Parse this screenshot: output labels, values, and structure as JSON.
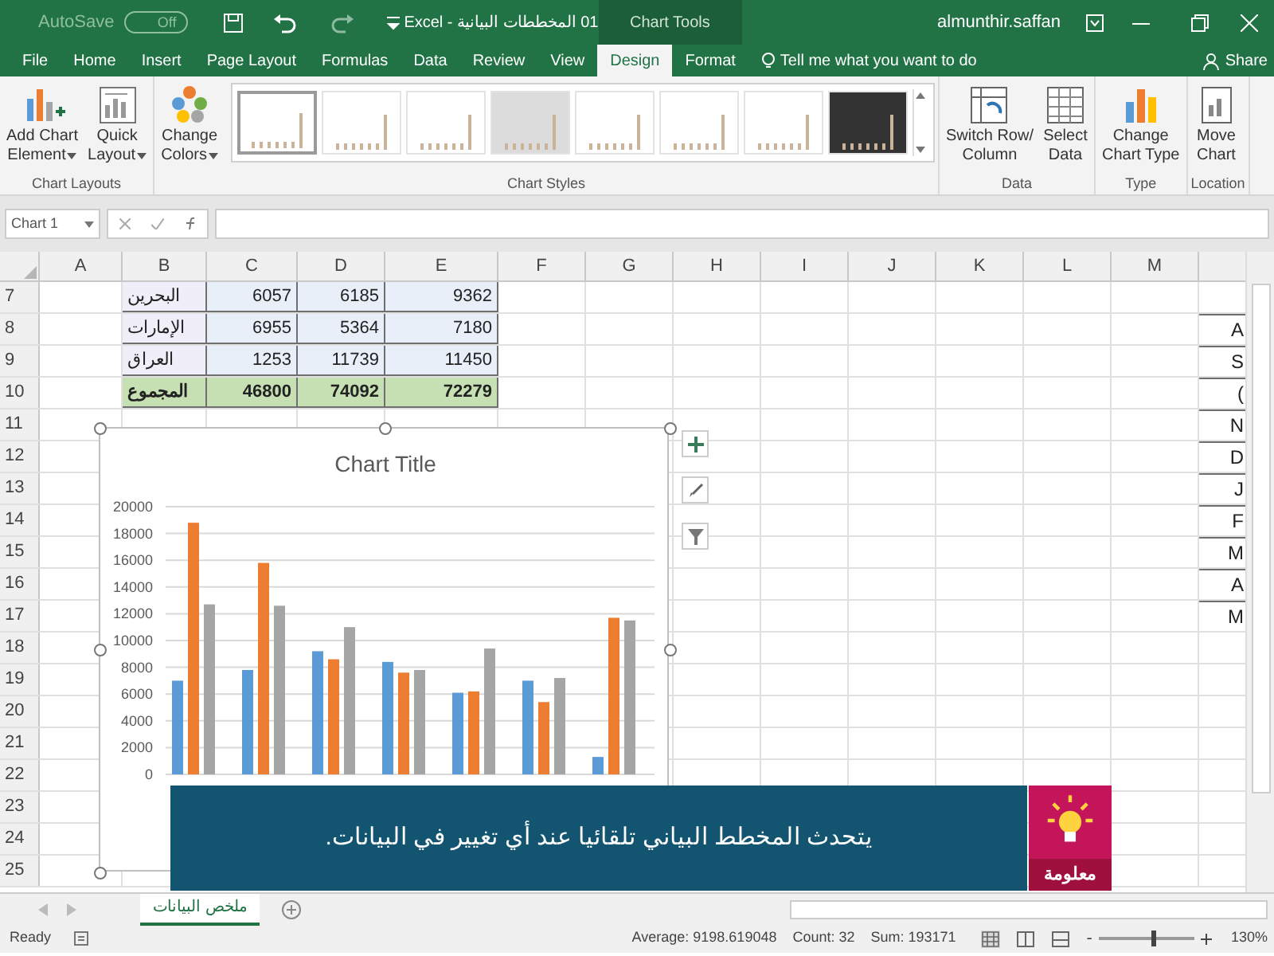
{
  "title_bar": {
    "autosave_label": "AutoSave",
    "autosave_state": "Off",
    "document_title": "01 المخططات البيانية - Excel",
    "context_label": "Chart Tools",
    "user": "almunthir.saffan"
  },
  "tabs": [
    {
      "label": "File",
      "selected": false
    },
    {
      "label": "Home",
      "selected": false
    },
    {
      "label": "Insert",
      "selected": false
    },
    {
      "label": "Page Layout",
      "selected": false
    },
    {
      "label": "Formulas",
      "selected": false
    },
    {
      "label": "Data",
      "selected": false
    },
    {
      "label": "Review",
      "selected": false
    },
    {
      "label": "View",
      "selected": false
    },
    {
      "label": "Design",
      "selected": true
    },
    {
      "label": "Format",
      "selected": false
    }
  ],
  "tell_me": "Tell me what you want to do",
  "share": "Share",
  "ribbon": {
    "groups": [
      {
        "label": "Chart Layouts",
        "buttons": [
          {
            "kind": "add-element",
            "lines": [
              "Add Chart",
              "Element"
            ],
            "dropdown": true
          },
          {
            "kind": "quick-layout",
            "lines": [
              "Quick",
              "Layout"
            ],
            "dropdown": true
          }
        ]
      },
      {
        "label": "Chart Styles",
        "buttons": [
          {
            "kind": "colors",
            "lines": [
              "Change",
              "Colors"
            ],
            "dropdown": true
          }
        ],
        "styles": [
          {
            "kind": "light",
            "selected": true
          },
          {
            "kind": "light",
            "selected": false
          },
          {
            "kind": "light",
            "selected": false
          },
          {
            "kind": "gray",
            "selected": false
          },
          {
            "kind": "light",
            "selected": false
          },
          {
            "kind": "light",
            "selected": false
          },
          {
            "kind": "light",
            "selected": false
          },
          {
            "kind": "dark",
            "selected": false
          }
        ]
      },
      {
        "label": "Data",
        "buttons": [
          {
            "kind": "switch",
            "lines": [
              "Switch Row/",
              "Column"
            ],
            "dropdown": false
          },
          {
            "kind": "select-data",
            "lines": [
              "Select",
              "Data"
            ],
            "dropdown": false
          }
        ]
      },
      {
        "label": "Type",
        "buttons": [
          {
            "kind": "chart-type",
            "lines": [
              "Change",
              "Chart Type"
            ],
            "dropdown": false
          }
        ]
      },
      {
        "label": "Location",
        "buttons": [
          {
            "kind": "move",
            "lines": [
              "Move",
              "Chart"
            ],
            "dropdown": false
          }
        ]
      }
    ]
  },
  "formula_bar": {
    "name_box": "Chart 1"
  },
  "columns": [
    "A",
    "B",
    "C",
    "D",
    "E",
    "F",
    "G",
    "H",
    "I",
    "J",
    "K",
    "L",
    "M"
  ],
  "rows": [
    {
      "number": "7",
      "kind": "data",
      "cells": [
        "البحرين",
        "6057",
        "6185",
        "9362"
      ]
    },
    {
      "number": "8",
      "kind": "data",
      "cells": [
        "الإمارات",
        "6955",
        "5364",
        "7180"
      ],
      "edge": "A"
    },
    {
      "number": "9",
      "kind": "data",
      "cells": [
        "العراق",
        "1253",
        "11739",
        "11450"
      ],
      "edge": "S"
    },
    {
      "number": "10",
      "kind": "total",
      "cells": [
        "المجموع",
        "46800",
        "74092",
        "72279"
      ],
      "edge": "("
    },
    {
      "number": "11",
      "kind": "empty",
      "edge": "N"
    },
    {
      "number": "12",
      "kind": "empty",
      "edge": "D"
    },
    {
      "number": "13",
      "kind": "empty",
      "edge": "J"
    },
    {
      "number": "14",
      "kind": "empty",
      "edge": "F"
    },
    {
      "number": "15",
      "kind": "empty",
      "edge": "M"
    },
    {
      "number": "16",
      "kind": "empty",
      "edge": "A"
    },
    {
      "number": "17",
      "kind": "empty",
      "edge": "M"
    },
    {
      "number": "18",
      "kind": "empty"
    },
    {
      "number": "19",
      "kind": "empty"
    },
    {
      "number": "20",
      "kind": "empty"
    },
    {
      "number": "21",
      "kind": "empty"
    },
    {
      "number": "22",
      "kind": "empty"
    },
    {
      "number": "23",
      "kind": "empty"
    },
    {
      "number": "24",
      "kind": "empty"
    },
    {
      "number": "25",
      "kind": "empty"
    }
  ],
  "chart": {
    "chart_data": {
      "type": "bar",
      "title": "Chart Title",
      "grid": true,
      "ylim": [
        0,
        20000
      ],
      "yticks": [
        0,
        2000,
        4000,
        6000,
        8000,
        10000,
        12000,
        14000,
        16000,
        18000,
        20000
      ],
      "series": [
        {
          "color": "#5b9bd5",
          "values": [
            7000,
            7800,
            9200,
            8400,
            6100,
            7000,
            1300
          ]
        },
        {
          "color": "#ed7d31",
          "values": [
            18800,
            15800,
            8600,
            7600,
            6200,
            5400,
            11700
          ]
        },
        {
          "color": "#a5a5a5",
          "values": [
            12700,
            12600,
            11000,
            7800,
            9400,
            7200,
            11500
          ]
        }
      ]
    }
  },
  "sheet_tabs": [
    {
      "label": "ملخص البيانات",
      "selected": true
    }
  ],
  "status_bar": {
    "mode": "Ready",
    "average": "Average: 9198.619048",
    "count": "Count: 32",
    "sum": "Sum: 193171",
    "zoom": "130%",
    "zoom_out": "-",
    "zoom_slider": {
      "level": 0.55
    }
  },
  "caption": {
    "text": "يتحدث المخطط البياني تلقائيا عند أي تغيير في البيانات.",
    "logo_text": "معلومة"
  }
}
